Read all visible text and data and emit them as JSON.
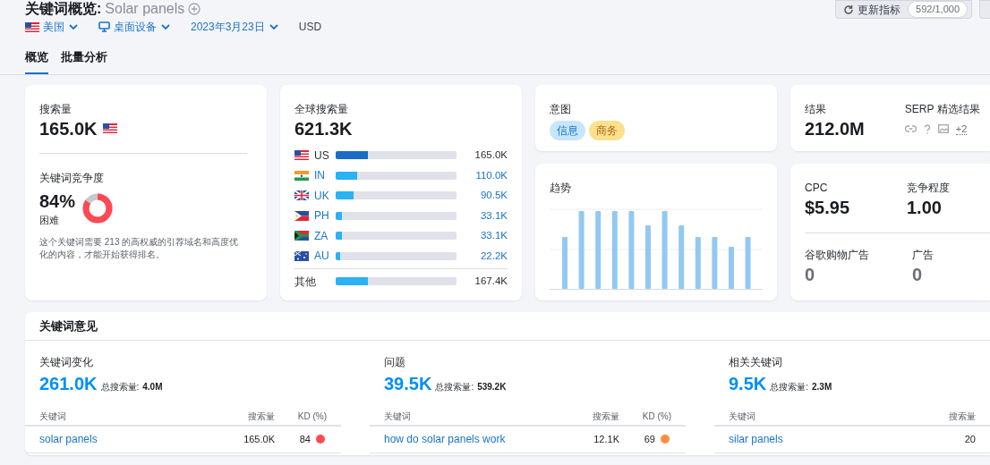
{
  "header": {
    "title": "关键词概览:",
    "keyword": "Solar panels",
    "update_button": {
      "label": "更新指标",
      "count": "592/1,000"
    }
  },
  "filters": [
    {
      "kind": "country",
      "label": "美国"
    },
    {
      "kind": "device",
      "label": "桌面设备"
    },
    {
      "kind": "date",
      "label": "2023年3月23日"
    },
    {
      "kind": "currency",
      "label": "USD"
    }
  ],
  "tabs": [
    {
      "label": "概览",
      "selected": true
    },
    {
      "label": "批量分析",
      "selected": false
    }
  ],
  "volume": {
    "label": "搜索量",
    "value": "165.0K"
  },
  "difficulty": {
    "label": "关键词竞争度",
    "value": "84%",
    "rating": "困难",
    "level": 0.84,
    "description": "这个关键词需要 213 的高权威的引荐域名和高度优化的内容，才能开始获得排名。"
  },
  "global_volume": {
    "label": "全球搜索量",
    "value": "621.3K",
    "countries": [
      {
        "code": "US",
        "value": "165.0K",
        "level": 0.27,
        "selected": true
      },
      {
        "code": "IN",
        "value": "110.0K",
        "level": 0.18,
        "selected": false
      },
      {
        "code": "UK",
        "value": "90.5K",
        "level": 0.145,
        "selected": false
      },
      {
        "code": "PH",
        "value": "33.1K",
        "level": 0.05,
        "selected": false
      },
      {
        "code": "ZA",
        "value": "33.1K",
        "level": 0.05,
        "selected": false
      },
      {
        "code": "AU",
        "value": "22.2K",
        "level": 0.035,
        "selected": false
      }
    ],
    "other": {
      "label": "其他",
      "value": "167.4K",
      "level": 0.27
    }
  },
  "intent": {
    "label": "意图",
    "tags": [
      {
        "label": "信息",
        "color": "#c7e6fb"
      },
      {
        "label": "商务",
        "color": "#fde08b"
      }
    ]
  },
  "trend": {
    "label": "趋势"
  },
  "results": {
    "label": "结果",
    "value": "212.0M",
    "serp_label": "SERP 精选结果",
    "serp_more": "+2"
  },
  "metrics": [
    {
      "label": "CPC",
      "value": "$5.95"
    },
    {
      "label": "竞争程度",
      "value": "1.00"
    },
    {
      "label": "谷歌购物广告",
      "value": "0"
    },
    {
      "label": "广告",
      "value": "0"
    }
  ],
  "ideas": {
    "title": "关键词意见",
    "groups": [
      {
        "title": "关键词变化",
        "count": "261.0K",
        "total_label": "总搜索量:",
        "total": "4.0M",
        "columns": [
          "关键词",
          "搜索量",
          "KD (%)"
        ],
        "rows": [
          {
            "keyword": "solar panels",
            "volume": "165.0K",
            "kd": "84",
            "color": "#ff4953"
          }
        ]
      },
      {
        "title": "问题",
        "count": "39.5K",
        "total_label": "总搜索量:",
        "total": "539.2K",
        "columns": [
          "关键词",
          "搜索量",
          "KD (%)"
        ],
        "rows": [
          {
            "keyword": "how do solar panels work",
            "volume": "12.1K",
            "kd": "69",
            "color": "#ff8c43"
          }
        ]
      },
      {
        "title": "相关关键词",
        "count": "9.5K",
        "total_label": "总搜索量:",
        "total": "2.3M",
        "columns": [
          "关键词",
          "搜索量"
        ],
        "rows": [
          {
            "keyword": "silar panels",
            "volume": "20"
          }
        ]
      }
    ]
  }
}
